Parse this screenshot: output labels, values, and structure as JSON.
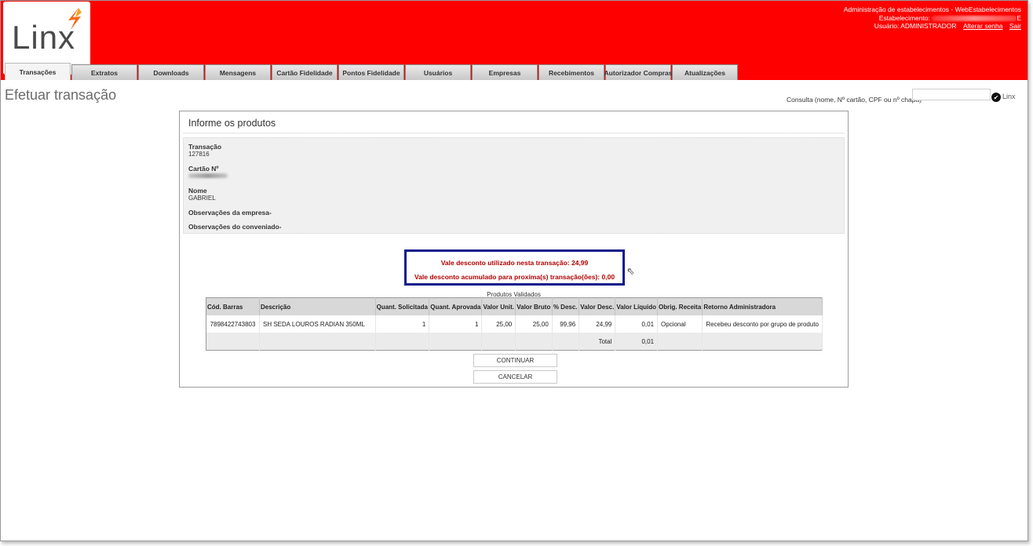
{
  "header": {
    "logo_text": "Linx",
    "admin_title": "Administração de estabelecimentos - WebEstabelecimentos",
    "estabelecimento_label": "Estabelecimento:",
    "estabelecimento_suffix": "E",
    "usuario_label": "Usuário: ADMINISTRADOR",
    "alterar_senha": "Alterar senha",
    "sair": "Sair",
    "brand_color": "#ff0000"
  },
  "tabs": [
    {
      "label": "Transações",
      "active": true
    },
    {
      "label": "Extratos"
    },
    {
      "label": "Downloads"
    },
    {
      "label": "Mensagens"
    },
    {
      "label": "Cartão Fidelidade"
    },
    {
      "label": "Pontos Fidelidade"
    },
    {
      "label": "Usuários"
    },
    {
      "label": "Empresas"
    },
    {
      "label": "Recebimentos"
    },
    {
      "label": "Autorizador Compras"
    },
    {
      "label": "Atualizações"
    }
  ],
  "page": {
    "title": "Efetuar transação",
    "search_label": "Consulta (nome, Nº cartão, CPF ou nº chapa)",
    "search_value": "",
    "mini_logo": "Linx"
  },
  "panel": {
    "title": "Informe os produtos",
    "transacao_label": "Transação",
    "transacao_value": "127816",
    "cartao_label": "Cartão Nº",
    "nome_label": "Nome",
    "nome_value": "GABRIEL",
    "obs_empresa_label": "Observações da empresa-",
    "obs_conveniado_label": "Observações do conveniado-",
    "msg_vale_utilizado": "Vale desconto utilizado nesta transação: 24,99",
    "msg_vale_acumulado": "Vale desconto acumulado para proxima(s) transação(ões): 0,00",
    "table_caption": "Produtos Validados",
    "highlight_color": "#0f1b8a",
    "message_color": "#b30000"
  },
  "table": {
    "headers": [
      "Cód. Barras",
      "Descrição",
      "Quant. Solicitada",
      "Quant. Aprovada",
      "Valor Unit.",
      "Valor Bruto",
      "% Desc.",
      "Valor Desc.",
      "Valor Líquido",
      "Obrig. Receita",
      "Retorno Administradora"
    ],
    "row": {
      "codigo": "7898422743803",
      "descricao": "SH SEDA LOUROS RADIAN 350ML",
      "qtd_solicitada": "1",
      "qtd_aprovada": "1",
      "valor_unit": "25,00",
      "valor_bruto": "25,00",
      "pct_desc": "99,96",
      "valor_desc": "24,99",
      "valor_liquido": "0,01",
      "obrig_receita": "Opcional",
      "retorno": "Recebeu desconto por grupo de produto"
    },
    "total_label": "Total",
    "total_value": "0,01"
  },
  "buttons": {
    "continuar": "CONTINUAR",
    "cancelar": "CANCELAR"
  }
}
